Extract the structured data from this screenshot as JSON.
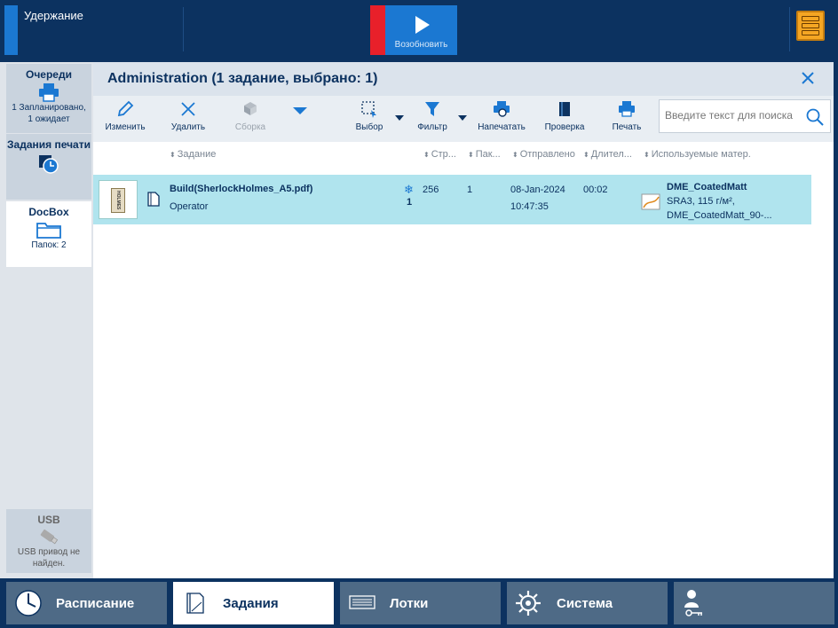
{
  "topbar": {
    "hold_label": "Удержание",
    "resume_label": "Возобновить"
  },
  "leftnav": {
    "queues": {
      "title": "Очереди",
      "line1": "1 Запланировано,",
      "line2": "1 ожидает"
    },
    "print_jobs": {
      "title": "Задания печати"
    },
    "docbox": {
      "title": "DocBox",
      "sub": "Папок: 2"
    },
    "usb": {
      "title": "USB",
      "line1": "USB привод не",
      "line2": "найден."
    }
  },
  "panel": {
    "title": "Administration (1 задание, выбрано: 1)"
  },
  "toolbar": {
    "edit": "Изменить",
    "delete": "Удалить",
    "assemble": "Сборка",
    "select": "Выбор",
    "filter": "Фильтр",
    "print_proof": "Напечатать",
    "check": "Проверка",
    "print": "Печать",
    "search_placeholder": "Введите текст для поиска"
  },
  "columns": {
    "job": "Задание",
    "pages": "Стр...",
    "batches": "Пак...",
    "sent": "Отправлено",
    "duration": "Длител...",
    "media": "Используемые матер."
  },
  "job": {
    "thumb_text": "HOLMES",
    "name": "Build(SherlockHolmes_A5.pdf)",
    "owner": "Operator",
    "copies": "1",
    "pages": "256",
    "batches": "1",
    "date": "08-Jan-2024",
    "time": "10:47:35",
    "duration": "00:02",
    "media_name": "DME_CoatedMatt",
    "media_spec": "SRA3, 115 г/м²,",
    "media_extra": "DME_CoatedMatt_90-..."
  },
  "bottom_tabs": {
    "schedule": "Расписание",
    "jobs": "Задания",
    "trays": "Лотки",
    "system": "Система"
  },
  "colors": {
    "dark_navy": "#0c3260",
    "accent_blue": "#1b78d2",
    "alert_red": "#e8202a",
    "selected_row": "#b0e4ee",
    "warning_orange": "#f5a623"
  }
}
